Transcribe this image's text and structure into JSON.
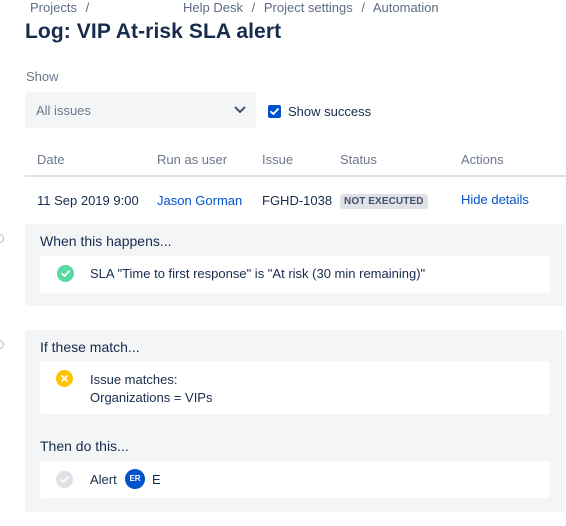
{
  "breadcrumb": {
    "projects": "Projects",
    "separator": "/",
    "help_desk": "Help Desk",
    "project_settings": "Project settings",
    "automation": "Automation"
  },
  "page": {
    "title": "Log: VIP At-risk SLA alert"
  },
  "filters": {
    "show_label": "Show",
    "select_value": "All issues",
    "show_success_label": "Show success",
    "show_success_checked": true
  },
  "table": {
    "headers": {
      "date": "Date",
      "run_as_user": "Run as user",
      "issue": "Issue",
      "status": "Status",
      "actions": "Actions"
    },
    "row": {
      "date": "11 Sep 2019 9:00",
      "user": "Jason Gorman",
      "issue": "FGHD-1038",
      "status": "NOT EXECUTED",
      "action": "Hide details"
    }
  },
  "trigger": {
    "heading": "When this happens...",
    "text": "SLA \"Time to first response\" is \"At risk (30 min remaining)\"",
    "status": "success"
  },
  "condition": {
    "heading": "If these match...",
    "line1": "Issue matches:",
    "line2": "Organizations = VIPs",
    "status": "warning"
  },
  "action": {
    "heading": "Then do this...",
    "label": "Alert",
    "avatar_initials": "ER",
    "recipient": "E",
    "status": "skipped"
  },
  "colors": {
    "primary": "#0052cc",
    "success": "#57d9a3",
    "warning": "#ffc400",
    "skipped": "#dfe1e6",
    "panel_bg": "#f4f5f7"
  },
  "icons": {
    "select_chevron": "chevron-down-icon",
    "checkbox": "checkmark-icon",
    "trigger_status": "check-circle-icon",
    "condition_status": "cross-circle-icon",
    "action_status": "check-circle-icon"
  }
}
